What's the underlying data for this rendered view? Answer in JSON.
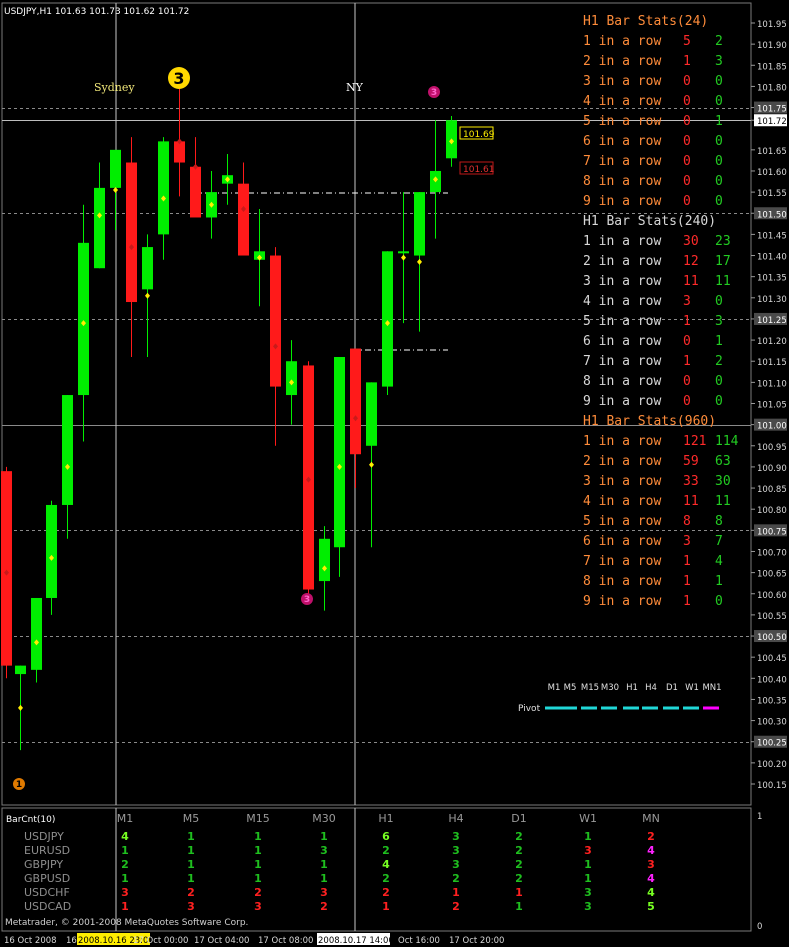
{
  "chart_header": "USDJPY,H1  101.63 101.73 101.62 101.72",
  "session_labels": [
    "Sydney",
    "NY"
  ],
  "pattern_markers": [
    "1",
    "3",
    "3",
    "3"
  ],
  "price_axis": [
    "101.95",
    "101.90",
    "101.85",
    "101.80",
    "101.75",
    "101.72",
    "101.65",
    "101.60",
    "101.55",
    "101.50",
    "101.45",
    "101.40",
    "101.35",
    "101.30",
    "101.25",
    "101.20",
    "101.15",
    "101.10",
    "101.05",
    "101.00",
    "100.95",
    "100.90",
    "100.85",
    "100.80",
    "100.75",
    "100.70",
    "100.65",
    "100.60",
    "100.55",
    "100.50",
    "100.45",
    "100.40",
    "100.35",
    "100.30",
    "100.25",
    "100.20",
    "100.15"
  ],
  "price_tags": [
    "101.69",
    "101.61"
  ],
  "stats": [
    {
      "title": "H1 Bar Stats(24)",
      "rows": [
        {
          "label": "1 in a row",
          "down": "5",
          "up": "2"
        },
        {
          "label": "2 in a row",
          "down": "1",
          "up": "3"
        },
        {
          "label": "3 in a row",
          "down": "0",
          "up": "0"
        },
        {
          "label": "4 in a row",
          "down": "0",
          "up": "0"
        },
        {
          "label": "5 in a row",
          "down": "0",
          "up": "1"
        },
        {
          "label": "6 in a row",
          "down": "0",
          "up": "0"
        },
        {
          "label": "7 in a row",
          "down": "0",
          "up": "0"
        },
        {
          "label": "8 in a row",
          "down": "0",
          "up": "0"
        },
        {
          "label": "9 in a row",
          "down": "0",
          "up": "0"
        }
      ]
    },
    {
      "title": "H1 Bar Stats(240)",
      "rows": [
        {
          "label": "1 in a row",
          "down": "30",
          "up": "23"
        },
        {
          "label": "2 in a row",
          "down": "12",
          "up": "17"
        },
        {
          "label": "3 in a row",
          "down": "11",
          "up": "11"
        },
        {
          "label": "4 in a row",
          "down": "3",
          "up": "0"
        },
        {
          "label": "5 in a row",
          "down": "1",
          "up": "3"
        },
        {
          "label": "6 in a row",
          "down": "0",
          "up": "1"
        },
        {
          "label": "7 in a row",
          "down": "1",
          "up": "2"
        },
        {
          "label": "8 in a row",
          "down": "0",
          "up": "0"
        },
        {
          "label": "9 in a row",
          "down": "0",
          "up": "0"
        }
      ]
    },
    {
      "title": "H1 Bar Stats(960)",
      "rows": [
        {
          "label": "1 in a row",
          "down": "121",
          "up": "114"
        },
        {
          "label": "2 in a row",
          "down": "59",
          "up": "63"
        },
        {
          "label": "3 in a row",
          "down": "33",
          "up": "30"
        },
        {
          "label": "4 in a row",
          "down": "11",
          "up": "11"
        },
        {
          "label": "5 in a row",
          "down": "8",
          "up": "8"
        },
        {
          "label": "6 in a row",
          "down": "3",
          "up": "7"
        },
        {
          "label": "7 in a row",
          "down": "1",
          "up": "4"
        },
        {
          "label": "8 in a row",
          "down": "1",
          "up": "1"
        },
        {
          "label": "9 in a row",
          "down": "1",
          "up": "0"
        }
      ]
    }
  ],
  "pivot": {
    "timeframes": [
      "M1",
      "M5",
      "M15",
      "M30",
      "H1",
      "H4",
      "D1",
      "W1",
      "MN1"
    ],
    "label": "Pivot"
  },
  "barcnt": {
    "title": "BarCnt(10)",
    "timeframes": [
      "M1",
      "M5",
      "M15",
      "M30",
      "H1",
      "H4",
      "D1",
      "W1",
      "MN"
    ],
    "rows": [
      {
        "symbol": "USDJPY",
        "cells": [
          {
            "v": "4",
            "c": "bright"
          },
          {
            "v": "1",
            "c": "green"
          },
          {
            "v": "1",
            "c": "green"
          },
          {
            "v": "1",
            "c": "green"
          },
          {
            "v": "6",
            "c": "bright"
          },
          {
            "v": "3",
            "c": "green"
          },
          {
            "v": "2",
            "c": "green"
          },
          {
            "v": "1",
            "c": "green"
          },
          {
            "v": "2",
            "c": "red"
          }
        ]
      },
      {
        "symbol": "EURUSD",
        "cells": [
          {
            "v": "1",
            "c": "green"
          },
          {
            "v": "1",
            "c": "green"
          },
          {
            "v": "1",
            "c": "green"
          },
          {
            "v": "3",
            "c": "green"
          },
          {
            "v": "2",
            "c": "green"
          },
          {
            "v": "3",
            "c": "green"
          },
          {
            "v": "2",
            "c": "green"
          },
          {
            "v": "3",
            "c": "red"
          },
          {
            "v": "4",
            "c": "magenta"
          }
        ]
      },
      {
        "symbol": "GBPJPY",
        "cells": [
          {
            "v": "2",
            "c": "green"
          },
          {
            "v": "1",
            "c": "green"
          },
          {
            "v": "1",
            "c": "green"
          },
          {
            "v": "1",
            "c": "green"
          },
          {
            "v": "4",
            "c": "bright"
          },
          {
            "v": "3",
            "c": "green"
          },
          {
            "v": "2",
            "c": "green"
          },
          {
            "v": "1",
            "c": "green"
          },
          {
            "v": "3",
            "c": "red"
          }
        ]
      },
      {
        "symbol": "GBPUSD",
        "cells": [
          {
            "v": "1",
            "c": "green"
          },
          {
            "v": "1",
            "c": "green"
          },
          {
            "v": "1",
            "c": "green"
          },
          {
            "v": "1",
            "c": "green"
          },
          {
            "v": "2",
            "c": "green"
          },
          {
            "v": "2",
            "c": "green"
          },
          {
            "v": "2",
            "c": "green"
          },
          {
            "v": "1",
            "c": "green"
          },
          {
            "v": "4",
            "c": "magenta"
          }
        ]
      },
      {
        "symbol": "USDCHF",
        "cells": [
          {
            "v": "3",
            "c": "red"
          },
          {
            "v": "2",
            "c": "red"
          },
          {
            "v": "2",
            "c": "red"
          },
          {
            "v": "3",
            "c": "red"
          },
          {
            "v": "2",
            "c": "red"
          },
          {
            "v": "1",
            "c": "red"
          },
          {
            "v": "1",
            "c": "red"
          },
          {
            "v": "3",
            "c": "green"
          },
          {
            "v": "4",
            "c": "bright"
          }
        ]
      },
      {
        "symbol": "USDCAD",
        "cells": [
          {
            "v": "1",
            "c": "red"
          },
          {
            "v": "3",
            "c": "red"
          },
          {
            "v": "3",
            "c": "red"
          },
          {
            "v": "2",
            "c": "red"
          },
          {
            "v": "1",
            "c": "red"
          },
          {
            "v": "2",
            "c": "red"
          },
          {
            "v": "1",
            "c": "green"
          },
          {
            "v": "3",
            "c": "green"
          },
          {
            "v": "5",
            "c": "bright"
          }
        ]
      }
    ]
  },
  "copyright": "Metatrader, © 2001-2008 MetaQuotes Software Corp.",
  "indicator_axis": [
    "1",
    "0"
  ],
  "time_axis": [
    "16 Oct 2008",
    "16",
    "2008.10.16 23:00",
    "17 Oct 00:00",
    "17 Oct 04:00",
    "17 Oct 08:00",
    "2008.10.17 14:00",
    "Oct 16:00",
    "17 Oct 20:00"
  ],
  "colors": {
    "bull": "#00ee00",
    "bear": "#ff1a1a",
    "orange": "#ff8c3a",
    "green_text": "#22cc22",
    "red_text": "#ff2a2a",
    "bright_green": "#66ff00",
    "magenta": "#ff00ff",
    "cyan": "#20d8d8",
    "yellow": "#ffee00"
  }
}
